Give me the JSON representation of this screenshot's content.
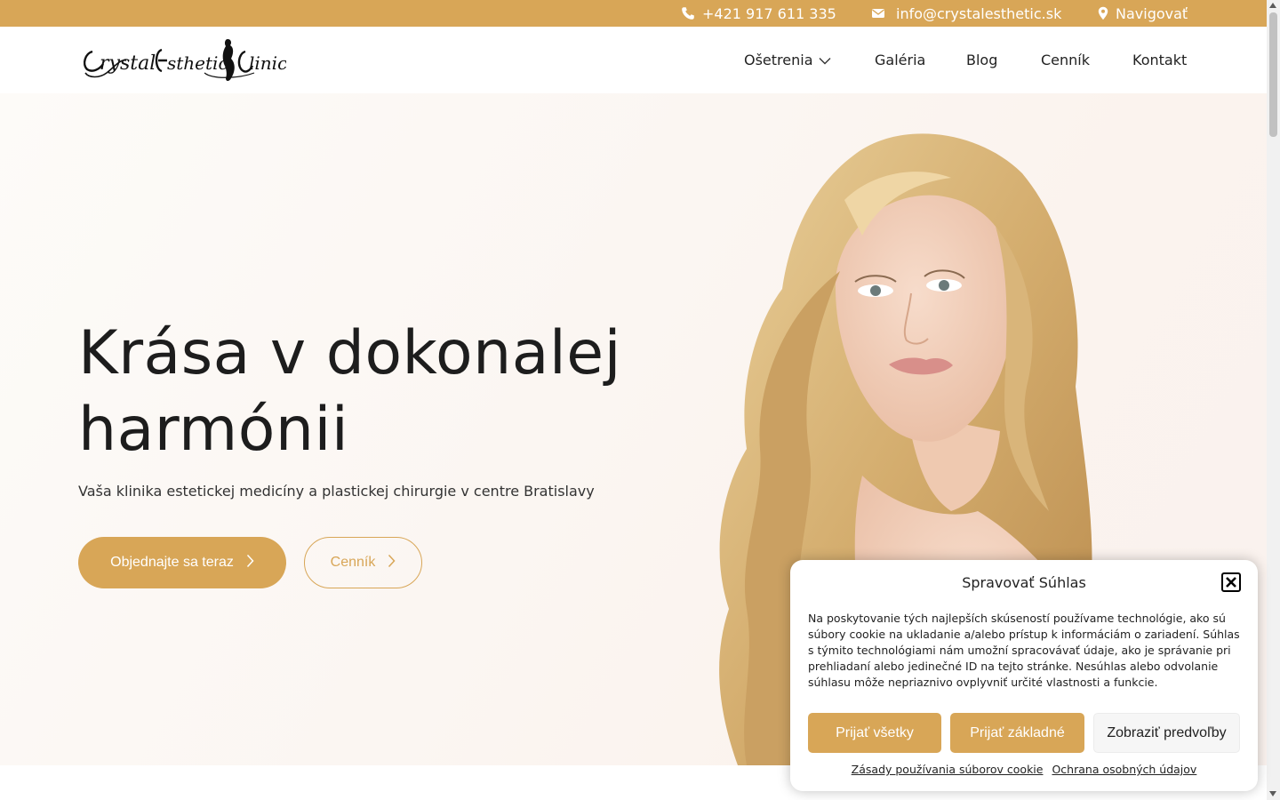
{
  "colors": {
    "accent": "#d8a657",
    "text": "#222222",
    "hero_bg": "#fbf6f2"
  },
  "topbar": {
    "phone": {
      "icon": "phone-icon",
      "label": "+421 917 611 335"
    },
    "email": {
      "icon": "envelope-icon",
      "label": "info@crystalesthetic.sk"
    },
    "navigate": {
      "icon": "map-pin-icon",
      "label": "Navigovať"
    }
  },
  "header": {
    "logo_text": "Crystal Esthetic Clinic",
    "nav": [
      {
        "label": "Ošetrenia",
        "has_dropdown": true
      },
      {
        "label": "Galéria"
      },
      {
        "label": "Blog"
      },
      {
        "label": "Cenník"
      },
      {
        "label": "Kontakt"
      }
    ]
  },
  "hero": {
    "title_line1": "Krása v dokonalej",
    "title_line2": "harmónii",
    "subtitle": "Vaša klinika estetickej medicíny a plastickej chirurgie v centre Bratislavy",
    "primary_button": "Objednajte sa teraz",
    "secondary_button": "Cenník"
  },
  "cookie": {
    "title": "Spravovať Súhlas",
    "text": "Na poskytovanie tých najlepších skúseností používame technológie, ako sú súbory cookie na ukladanie a/alebo prístup k informáciám o zariadení. Súhlas s týmito technológiami nám umožní spracovávať údaje, ako je správanie pri prehliadaní alebo jedinečné ID na tejto stránke. Nesúhlas alebo odvolanie súhlasu môže nepriaznivo ovplyvniť určité vlastnosti a funkcie.",
    "accept_all": "Prijať všetky",
    "accept_basic": "Prijať základné",
    "show_preferences": "Zobraziť predvoľby",
    "cookie_policy_link": "Zásady používania súborov cookie",
    "privacy_link": "Ochrana osobných údajov"
  }
}
